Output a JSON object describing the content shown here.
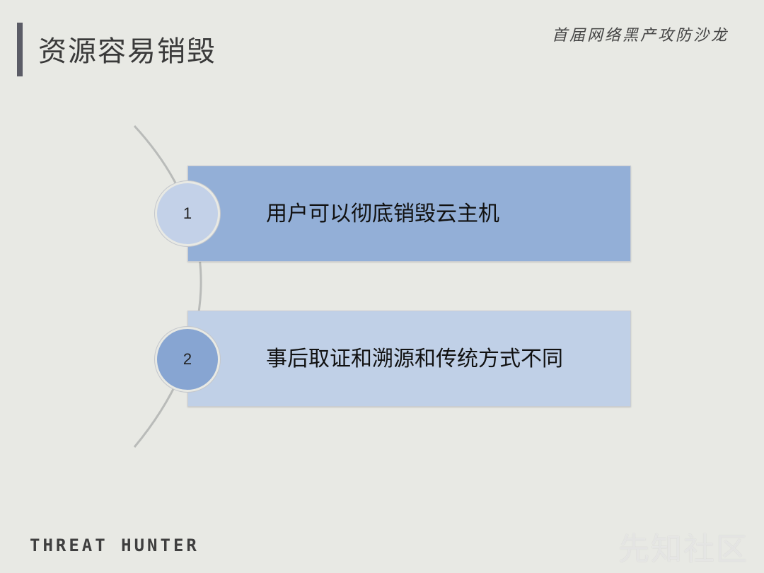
{
  "slide": {
    "title": "资源容易销毁",
    "event": "首届网络黑产攻防沙龙",
    "items": [
      {
        "number": "1",
        "text": "用户可以彻底销毁云主机"
      },
      {
        "number": "2",
        "text": "事后取证和溯源和传统方式不同"
      }
    ],
    "brand": "THREAT HUNTER",
    "watermark": "先知社区"
  },
  "colors": {
    "background": "#e8e9e4",
    "item1_fill": "#93afd7",
    "item2_fill": "#c0d0e7",
    "circle1_fill": "#c3d1e8",
    "circle2_fill": "#87a5d2",
    "title_bar": "#5b5c66"
  }
}
